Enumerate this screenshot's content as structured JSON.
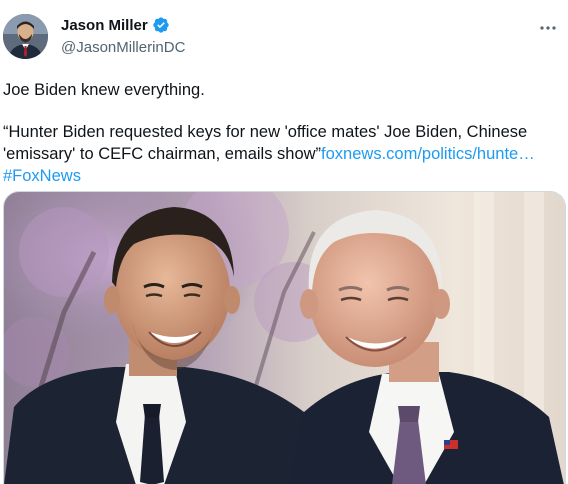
{
  "author": {
    "display_name": "Jason Miller",
    "handle": "@JasonMillerinDC",
    "verified": true,
    "avatar_icon": "person-avatar-icon"
  },
  "menu": {
    "more_icon": "more-horizontal-icon"
  },
  "tweet": {
    "line1": "Joe Biden knew everything.",
    "quote": "“Hunter Biden requested keys for new 'office mates' Joe Biden, Chinese 'emissary' to CEFC chairman, emails show”",
    "link_text": "foxnews.com/politics/hunte…",
    "hashtag": "#FoxNews"
  },
  "colors": {
    "link": "#1d9bf0",
    "verified": "#1d9bf0",
    "text": "#0f1419",
    "muted": "#536471"
  },
  "media": {
    "icon": "photo-two-men-smiling"
  }
}
